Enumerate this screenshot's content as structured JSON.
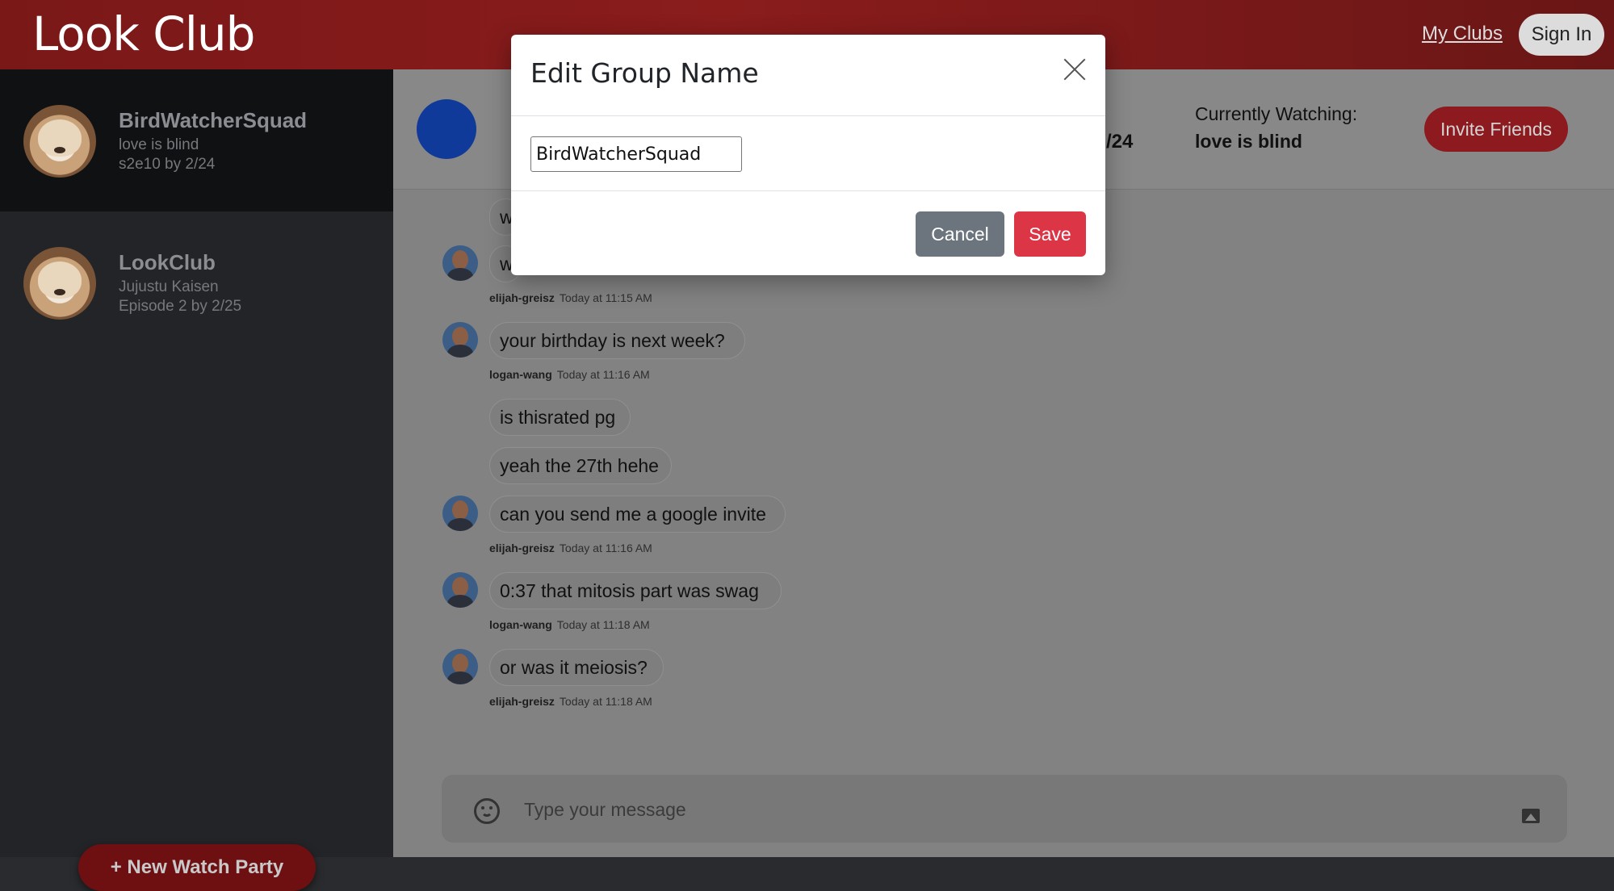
{
  "app": {
    "brand": "Look Club"
  },
  "nav": {
    "my_clubs": "My Clubs",
    "sign_in": "Sign In"
  },
  "sidebar": {
    "clubs": [
      {
        "name": "BirdWatcherSquad",
        "line1": "love is blind",
        "line2": "s2e10 by 2/24",
        "active": true
      },
      {
        "name": "LookClub",
        "line1": "Jujustu Kaisen",
        "line2": "Episode 2 by 2/25",
        "active": false
      }
    ],
    "new_party": "+ New Watch Party"
  },
  "chat_header": {
    "partial_text": "/24",
    "currently_watching_label": "Currently Watching:",
    "currently_watching_value": "love is blind",
    "invite_label": "Invite Friends"
  },
  "messages": {
    "partial_bubble_1": "w",
    "partial_bubble_2": "w",
    "meta_1": {
      "user": "elijah-greisz",
      "time": "Today at 11:15 AM"
    },
    "msg_3": "your birthday is next week?",
    "meta_3": {
      "user": "logan-wang",
      "time": "Today at 11:16 AM"
    },
    "msg_4": "is thisrated pg",
    "msg_5": "yeah the 27th hehe",
    "msg_6": "can you send me a google invite",
    "meta_6": {
      "user": "elijah-greisz",
      "time": "Today at 11:16 AM"
    },
    "msg_7": "0:37 that mitosis part was swag",
    "meta_7": {
      "user": "logan-wang",
      "time": "Today at 11:18 AM"
    },
    "msg_8": "or was it meiosis?",
    "meta_8": {
      "user": "elijah-greisz",
      "time": "Today at 11:18 AM"
    }
  },
  "composer": {
    "placeholder": "Type your message"
  },
  "modal": {
    "title": "Edit Group Name",
    "field_value": "BirdWatcherSquad",
    "cancel_label": "Cancel",
    "save_label": "Save"
  },
  "colors": {
    "brand_red": "#8a1c1c",
    "save_red": "#dc3545",
    "cancel_gray": "#6c757d",
    "group_blue": "#0f3a99"
  }
}
